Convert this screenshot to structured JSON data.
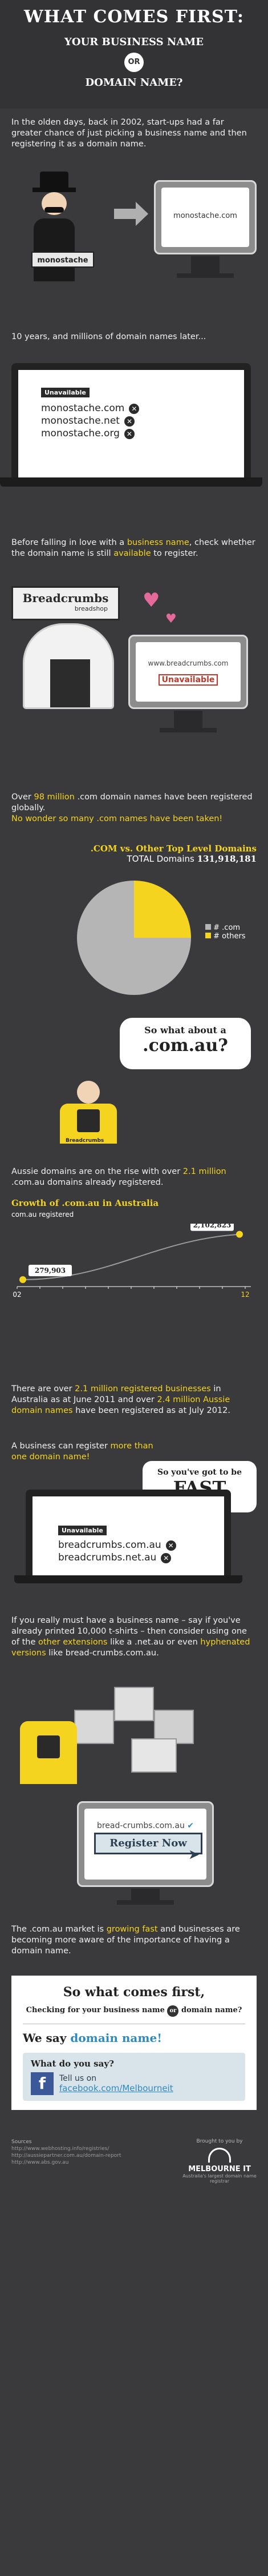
{
  "header": {
    "title": "WHAT COMES FIRST:",
    "line1": "YOUR BUSINESS NAME",
    "or": "OR",
    "line2": "DOMAIN NAME?"
  },
  "s1": {
    "text": "In the olden days, back in 2002, start-ups had a far greater chance of just picking a business name and then registering it as a domain name.",
    "sign": "monostache",
    "screen_domain": "monostache.com"
  },
  "s2": {
    "text": "10 years, and millions of domain names later...",
    "unavailable": "Unavailable",
    "domains": [
      "monostache.com",
      "monostache.net",
      "monostache.org"
    ]
  },
  "s3": {
    "text_before": "Before falling in love with a ",
    "text_highlight1": "business name",
    "text_mid": ", check whether the domain name is still ",
    "text_highlight2": "available",
    "text_after": " to register.",
    "shop_sign": "Breadcrumbs",
    "shop_sub": "breadshop",
    "screen_domain": "www.breadcrumbs.com",
    "unavailable": "Unavailable"
  },
  "s4": {
    "text_before": "Over ",
    "text_highlight": "98 million",
    "text_after": " .com domain names have been registered globally.",
    "text_yellow": "No wonder so many .com names have been taken!"
  },
  "chart_data": [
    {
      "type": "pie",
      "title": ".COM vs. Other Top Level Domains",
      "subtitle_label": "TOTAL Domains",
      "subtitle_value": "131,918,181",
      "legend": [
        "# .com",
        "# others"
      ],
      "colors": [
        "#b5b5b5",
        "#f5d41f"
      ],
      "values": [
        75,
        25
      ]
    },
    {
      "type": "line",
      "title": "Growth of .com.au in Australia",
      "ylabel": "com.au registered",
      "x": [
        "02",
        "12"
      ],
      "x_ticks_start": "02",
      "x_ticks_end": "12",
      "values_labelled": [
        "279,903",
        "2,102,823"
      ],
      "values": [
        279903,
        2102823
      ]
    }
  ],
  "s5": {
    "bubble_line1": "So what about a",
    "bubble_line2": ".com.au?",
    "shirt": "Breadcrumbs"
  },
  "s6": {
    "text_before": "Aussie domains are on the rise with over ",
    "text_highlight": "2.1 million",
    "text_after": " .com.au domains already registered."
  },
  "s7": {
    "p1_a": "There are over ",
    "p1_h1": "2.1 million registered businesses",
    "p1_b": " in Australia as at June 2011 and over ",
    "p1_h2": "2.4 million Aussie domain names",
    "p1_c": " have been registered as at July 2012.",
    "p2_a": "A business can register ",
    "p2_h": "more than one domain name!",
    "bubble_line1": "So you've got to be",
    "bubble_line2": "FAST",
    "unavailable": "Unavailable",
    "domains": [
      "breadcrumbs.com.au",
      "breadcrumbs.net.au"
    ]
  },
  "s8": {
    "text_a": "If you really must have a business name – say if you've already printed 10,000 t-shirts – then consider using one of the ",
    "text_h1": "other extensions",
    "text_b": " like a .net.au or even ",
    "text_h2": "hyphenated versions",
    "text_c": " like bread-crumbs.com.au.",
    "screen_domain": "bread-crumbs.com.au",
    "register": "Register Now"
  },
  "s9": {
    "text_a": "The .com.au market is ",
    "text_h": "growing fast",
    "text_b": " and businesses are becoming more aware of the importance of having a domain name."
  },
  "footer": {
    "card_title": "So what comes first,",
    "card_q1": "Checking for your business name",
    "card_or": "or",
    "card_q2": "domain name?",
    "we_say": "We say",
    "answer": "domain name!",
    "cta_q": "What do you say?",
    "cta_line1": "Tell us on",
    "cta_link": "facebook.com/Melbourneit",
    "sources_title": "Sources",
    "sources": [
      "http://www.webhosting.info/registries/",
      "http://aussiepartner.com.au/domain-report",
      "http://www.abs.gov.au"
    ],
    "brought": "Brought to you by",
    "logo": "MELBOURNE IT",
    "logo_sub": "Australia's largest domain name registrar"
  },
  "colors": {
    "accent": "#f5d41f",
    "background": "#3a3a3c",
    "header": "#333335"
  }
}
